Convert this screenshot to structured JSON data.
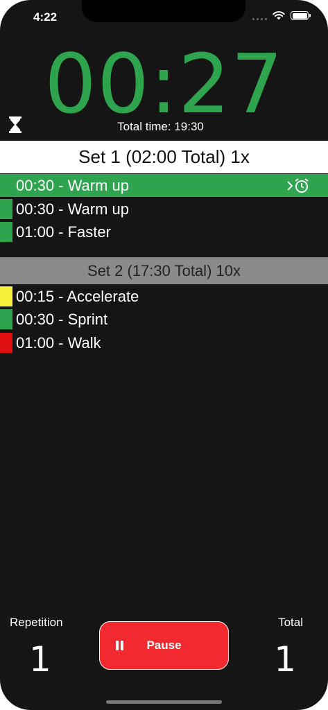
{
  "status_bar": {
    "time": "4:22"
  },
  "timer": {
    "current": "00:27",
    "total_time": "Total time: 19:30",
    "color": "#2ea44f"
  },
  "sets": [
    {
      "header": "Set 1 (02:00 Total) 1x",
      "items": [
        {
          "label": "00:30 - Warm up",
          "color": "#2ea44f",
          "active": true
        },
        {
          "label": "00:30 - Warm up",
          "color": "#2ea44f"
        },
        {
          "label": "01:00 - Faster",
          "color": "#2ea44f"
        }
      ]
    },
    {
      "header": "Set 2 (17:30 Total) 10x",
      "items": [
        {
          "label": "00:15 - Accelerate",
          "color": "#f7f03a"
        },
        {
          "label": "00:30 - Sprint",
          "color": "#2ea44f"
        },
        {
          "label": "01:00 - Walk",
          "color": "#e01010"
        }
      ]
    }
  ],
  "controls": {
    "repetition_label": "Repetition",
    "repetition_value": "1",
    "pause_label": "Pause",
    "total_label": "Total",
    "total_value": "1"
  },
  "icons": {
    "hourglass": "hourglass-icon",
    "alarm": "alarm-clock-icon",
    "pause": "pause-icon"
  }
}
